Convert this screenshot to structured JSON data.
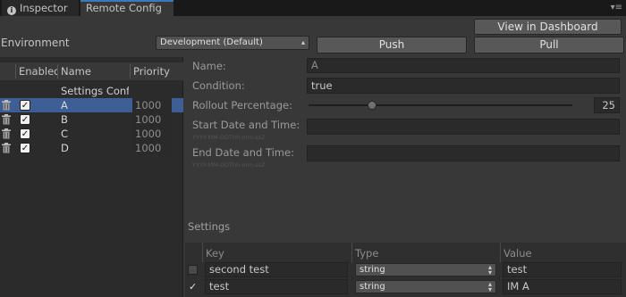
{
  "tabs": {
    "inspector": "Inspector",
    "remote_config": "Remote Config",
    "menu_glyph": "▾≡"
  },
  "toolbar": {
    "environment_label": "Environment",
    "environment_value": "Development (Default)",
    "view_dashboard": "View in Dashboard",
    "push": "Push",
    "pull": "Pull"
  },
  "list": {
    "headers": {
      "enabled": "Enabled",
      "name": "Name",
      "priority": "Priority"
    },
    "group_label": "Settings Config",
    "rows": [
      {
        "name": "A",
        "enabled": true,
        "priority": "1000",
        "selected": true
      },
      {
        "name": "B",
        "enabled": true,
        "priority": "1000",
        "selected": false
      },
      {
        "name": "C",
        "enabled": true,
        "priority": "1000",
        "selected": false
      },
      {
        "name": "D",
        "enabled": true,
        "priority": "1000",
        "selected": false
      }
    ]
  },
  "detail": {
    "name_label": "Name:",
    "name_value": "A",
    "condition_label": "Condition:",
    "condition_value": "true",
    "rollout_label": "Rollout Percentage:",
    "rollout_value": "25",
    "rollout_fraction": 0.25,
    "start_label": "Start Date and Time:",
    "start_hint": "YYYY-MM-DDThh:mm:ssZ",
    "start_value": "",
    "end_label": "End Date and Time:",
    "end_hint": "YYYY-MM-DDThh:mm:ssZ",
    "end_value": ""
  },
  "settings": {
    "title": "Settings",
    "headers": {
      "key": "Key",
      "type": "Type",
      "value": "Value"
    },
    "rows": [
      {
        "checked": false,
        "key": "second test",
        "type": "string",
        "value": "test"
      },
      {
        "checked": true,
        "key": "test",
        "type": "string",
        "value": "IM A"
      }
    ]
  },
  "colors": {
    "selection": "#3e5f96",
    "tab_accent": "#3a79bb",
    "background": "#383838"
  }
}
